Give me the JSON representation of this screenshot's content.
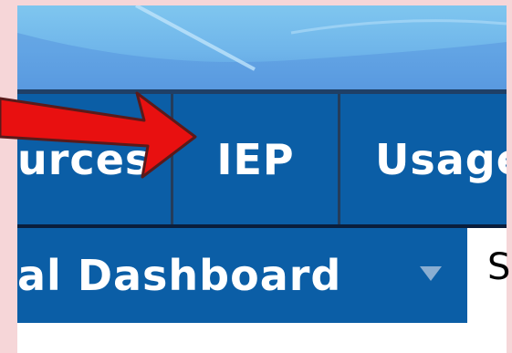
{
  "nav": {
    "tabs": [
      {
        "label": "urces"
      },
      {
        "label": "IEP"
      },
      {
        "label": "Usage"
      }
    ]
  },
  "subnav": {
    "dashboard_label": "al Dashboard",
    "next_label": "S"
  },
  "colors": {
    "nav_blue": "#0b5ea6",
    "nav_separator": "#243c5a",
    "banner_sky": "#7fc6ef",
    "frame_pink": "#f6d6d8",
    "annotation_arrow": "#e81010"
  },
  "icons": {
    "dropdown": "chevron-down-icon",
    "annotation": "arrow-annotation-icon"
  }
}
